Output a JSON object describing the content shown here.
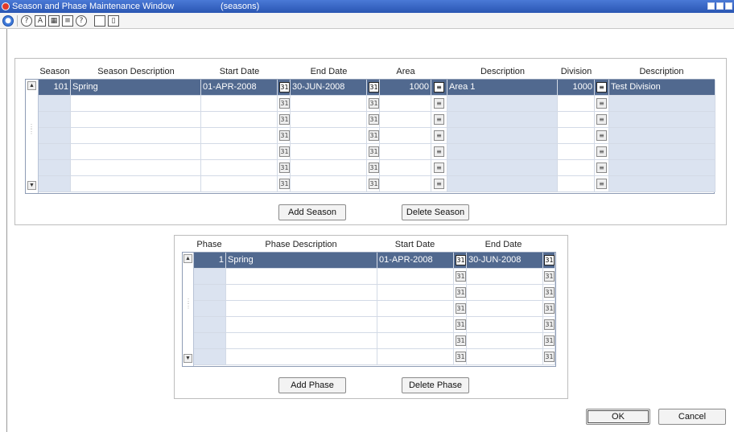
{
  "window": {
    "title": "Season and Phase Maintenance Window",
    "subtitle": "(seasons)"
  },
  "toolbar": {
    "icons": [
      "globe-icon",
      "help-icon",
      "spellcheck-icon",
      "calendar-icon",
      "notes-icon",
      "info-icon",
      "blank-icon",
      "new-document-icon"
    ]
  },
  "season_table": {
    "headers": [
      "Season",
      "Season Description",
      "Start Date",
      "End Date",
      "Area",
      "Description",
      "Division",
      "Description"
    ],
    "rows": [
      {
        "season": "101",
        "description": "Spring",
        "start_date": "01-APR-2008",
        "end_date": "30-JUN-2008",
        "area": "1000",
        "area_desc": "Area 1",
        "division": "1000",
        "division_desc": "Test Division"
      },
      {
        "season": "",
        "description": "",
        "start_date": "",
        "end_date": "",
        "area": "",
        "area_desc": "",
        "division": "",
        "division_desc": ""
      },
      {
        "season": "",
        "description": "",
        "start_date": "",
        "end_date": "",
        "area": "",
        "area_desc": "",
        "division": "",
        "division_desc": ""
      },
      {
        "season": "",
        "description": "",
        "start_date": "",
        "end_date": "",
        "area": "",
        "area_desc": "",
        "division": "",
        "division_desc": ""
      },
      {
        "season": "",
        "description": "",
        "start_date": "",
        "end_date": "",
        "area": "",
        "area_desc": "",
        "division": "",
        "division_desc": ""
      },
      {
        "season": "",
        "description": "",
        "start_date": "",
        "end_date": "",
        "area": "",
        "area_desc": "",
        "division": "",
        "division_desc": ""
      },
      {
        "season": "",
        "description": "",
        "start_date": "",
        "end_date": "",
        "area": "",
        "area_desc": "",
        "division": "",
        "division_desc": ""
      }
    ],
    "add_button": "Add Season",
    "delete_button": "Delete Season"
  },
  "phase_table": {
    "headers": [
      "Phase",
      "Phase Description",
      "Start Date",
      "End Date"
    ],
    "rows": [
      {
        "phase": "1",
        "description": "Spring",
        "start_date": "01-APR-2008",
        "end_date": "30-JUN-2008"
      },
      {
        "phase": "",
        "description": "",
        "start_date": "",
        "end_date": ""
      },
      {
        "phase": "",
        "description": "",
        "start_date": "",
        "end_date": ""
      },
      {
        "phase": "",
        "description": "",
        "start_date": "",
        "end_date": ""
      },
      {
        "phase": "",
        "description": "",
        "start_date": "",
        "end_date": ""
      },
      {
        "phase": "",
        "description": "",
        "start_date": "",
        "end_date": ""
      },
      {
        "phase": "",
        "description": "",
        "start_date": "",
        "end_date": ""
      }
    ],
    "add_button": "Add Phase",
    "delete_button": "Delete Phase"
  },
  "dialog": {
    "ok_button": "OK",
    "cancel_button": "Cancel"
  },
  "colors": {
    "titlebar": "#2a56b3",
    "selected_row": "#51698f",
    "shaded_cell": "#dbe3f0"
  }
}
